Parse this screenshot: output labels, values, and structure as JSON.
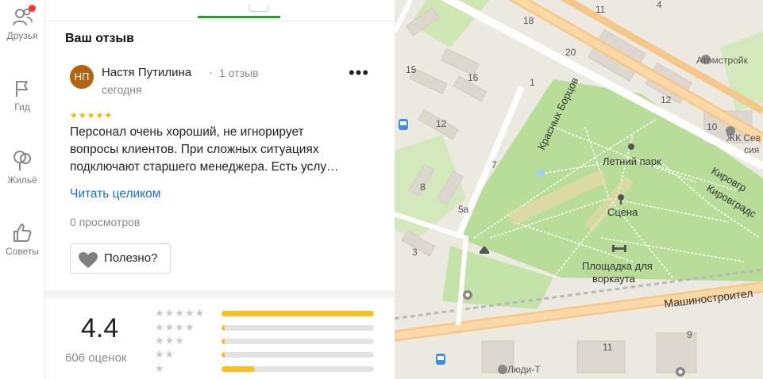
{
  "nav": {
    "friends": "Друзья",
    "guide": "Гид",
    "housing": "Жильё",
    "tips": "Советы"
  },
  "review": {
    "section_title": "Ваш отзыв",
    "avatar_initials": "НП",
    "author": "Настя Путилина",
    "author_review_count": "1 отзыв",
    "date": "сегодня",
    "more_icon": "•••",
    "stars": "★★★★★",
    "rating": 5,
    "text_lines": [
      "Персонал очень хороший, не игнорирует",
      "вопросы клиентов. При сложных ситуациях",
      "подключают старшего менеджера. Есть услу…"
    ],
    "read_more": "Читать целиком",
    "views": "0 просмотров",
    "useful_button": "Полезно?"
  },
  "summary": {
    "rating_value": "4.4",
    "rating_count": "606 оценок",
    "distribution": [
      {
        "stars": "★★★★★",
        "fraction": 1.0
      },
      {
        "stars": "★★★★",
        "fraction": 0.02
      },
      {
        "stars": "★★★",
        "fraction": 0.02
      },
      {
        "stars": "★★",
        "fraction": 0.02
      },
      {
        "stars": "★",
        "fraction": 0.22
      }
    ]
  },
  "map": {
    "labels": {
      "park": "Летний парк",
      "stage": "Сцена",
      "workout": "Площадка для",
      "workout2": "воркаута",
      "street_krasnykh": "Красных Борцов",
      "street_kirov1": "Кировгр",
      "street_kirov2": "Кировградс",
      "street_mashino": "Машиностроител",
      "atomstroy": "Атомстройк",
      "zhk1": "ЖК Сев",
      "zhk2": "сия",
      "lyudi": "Люди-Т"
    },
    "house_numbers": [
      "18",
      "11",
      "4",
      "20",
      "15",
      "16",
      "1",
      "12",
      "12",
      "10",
      "7",
      "8",
      "5а",
      "3",
      "11",
      "9"
    ]
  },
  "colors": {
    "accent_green": "#25a125",
    "link_blue": "#1a6fd1",
    "star_yellow": "#f5b800",
    "bar_yellow": "#fbbf24",
    "avatar_brown": "#b6610f",
    "park_green": "#b8dd99",
    "road_orange": "#f6c78a"
  }
}
